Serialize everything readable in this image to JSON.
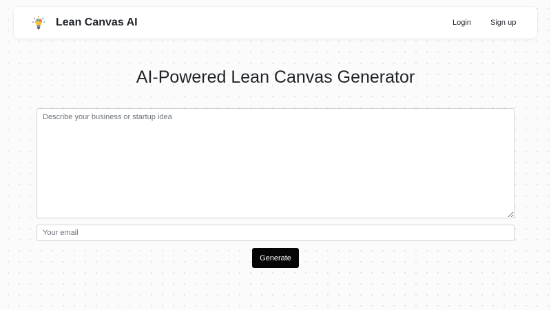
{
  "header": {
    "brand": "Lean Canvas AI",
    "logo_icon": "lightbulb-icon",
    "nav": {
      "login": "Login",
      "signup": "Sign up"
    }
  },
  "main": {
    "title": "AI-Powered Lean Canvas Generator",
    "idea_input": {
      "value": "",
      "placeholder": "Describe your business or startup idea"
    },
    "email_input": {
      "value": "",
      "placeholder": "Your email"
    },
    "generate_label": "Generate"
  },
  "colors": {
    "background": "#fbfbfc",
    "button": "#050505",
    "button_text": "#ffffff",
    "text": "#1f2328",
    "border": "#cfd3d8"
  }
}
